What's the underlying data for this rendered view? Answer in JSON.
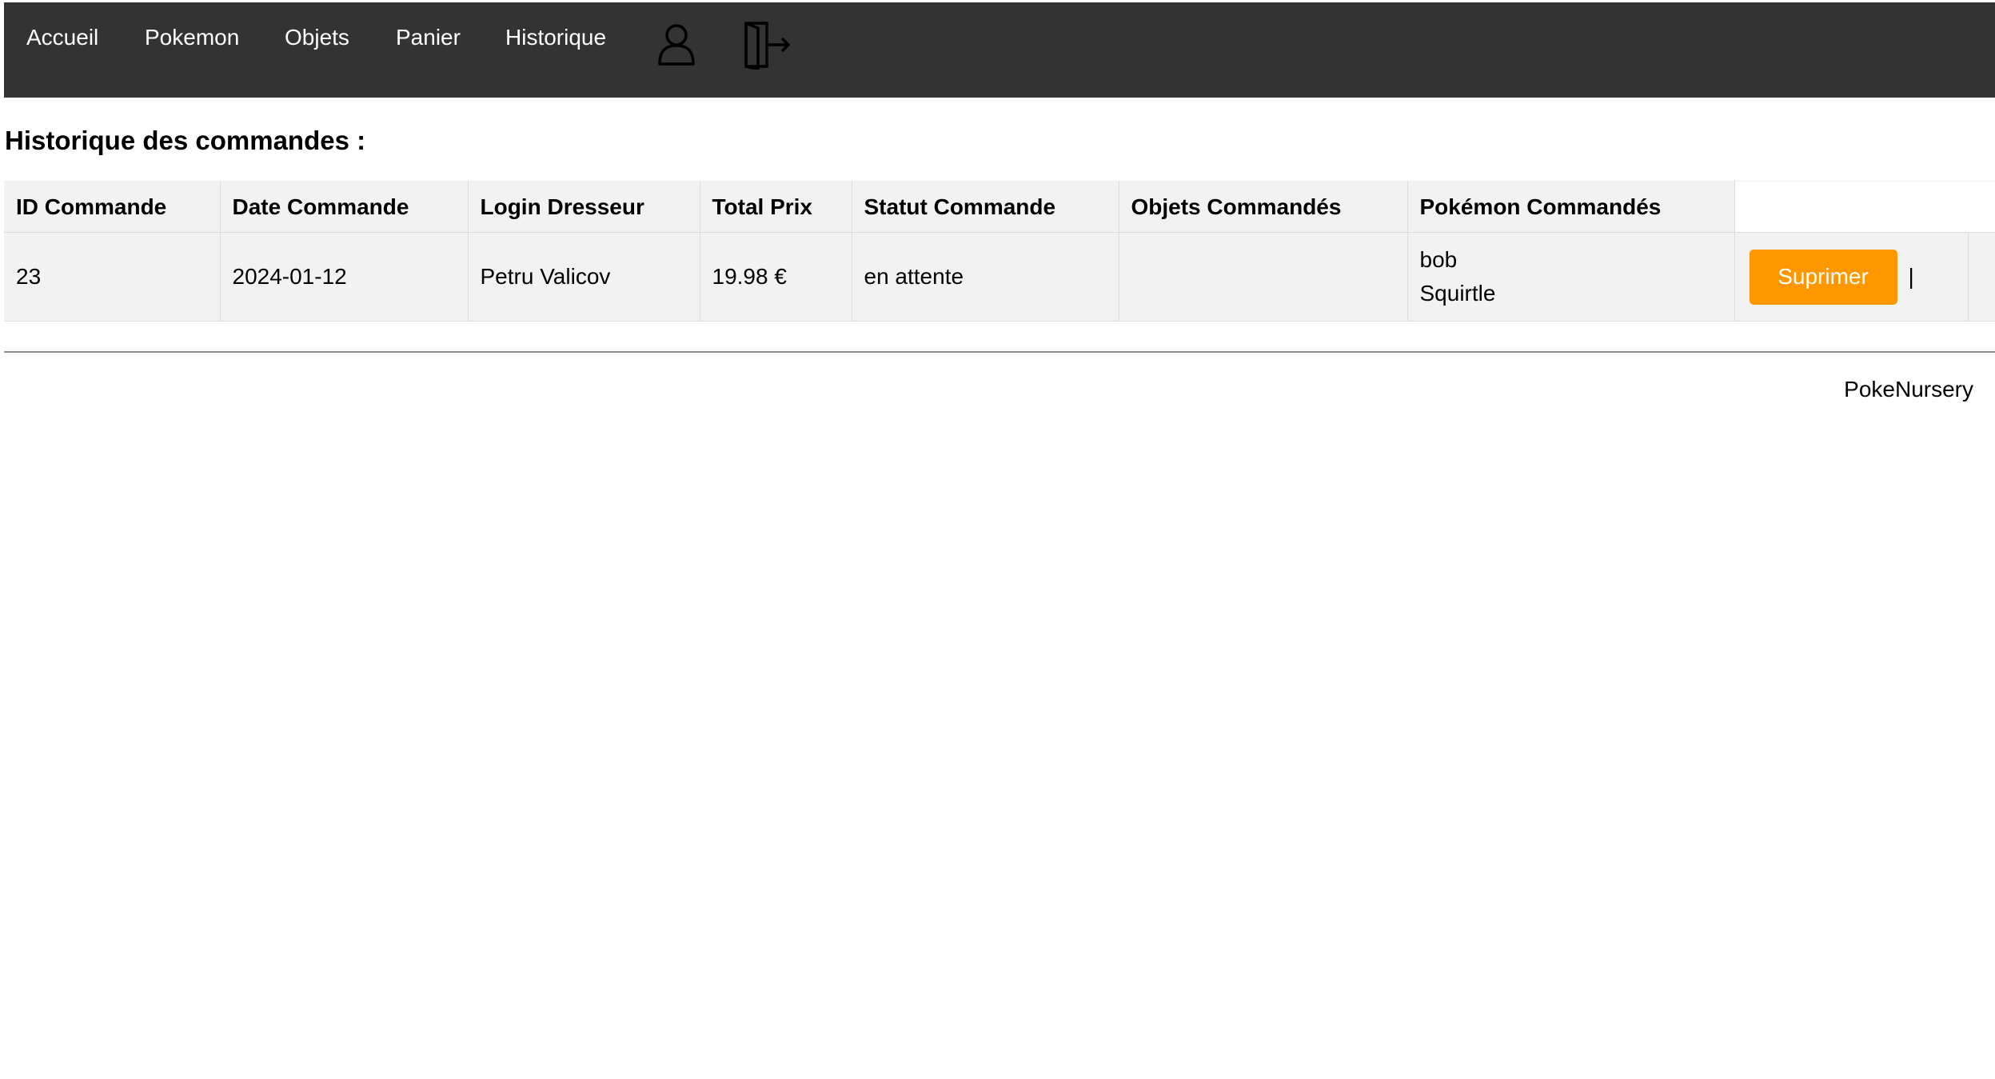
{
  "nav": {
    "links": [
      "Accueil",
      "Pokemon",
      "Objets",
      "Panier",
      "Historique"
    ],
    "icons": [
      "user-icon",
      "logout-icon"
    ]
  },
  "page": {
    "title": "Historique des commandes :"
  },
  "table": {
    "headers": [
      "ID Commande",
      "Date Commande",
      "Login Dresseur",
      "Total Prix",
      "Statut Commande",
      "Objets Commandés",
      "Pokémon Commandés"
    ],
    "rows": [
      {
        "id": "23",
        "date": "2024-01-12",
        "login": "Petru Valicov",
        "total": "19.98 €",
        "status": "en attente",
        "objects": "",
        "pokemon": [
          "bob",
          "Squirtle"
        ],
        "delete_label": "Suprimer",
        "separator": "|"
      }
    ]
  },
  "footer": {
    "brand": "PokeNursery"
  },
  "colors": {
    "nav_bg": "#333333",
    "accent": "#ff9800",
    "cell_bg": "#f2f2f2"
  }
}
